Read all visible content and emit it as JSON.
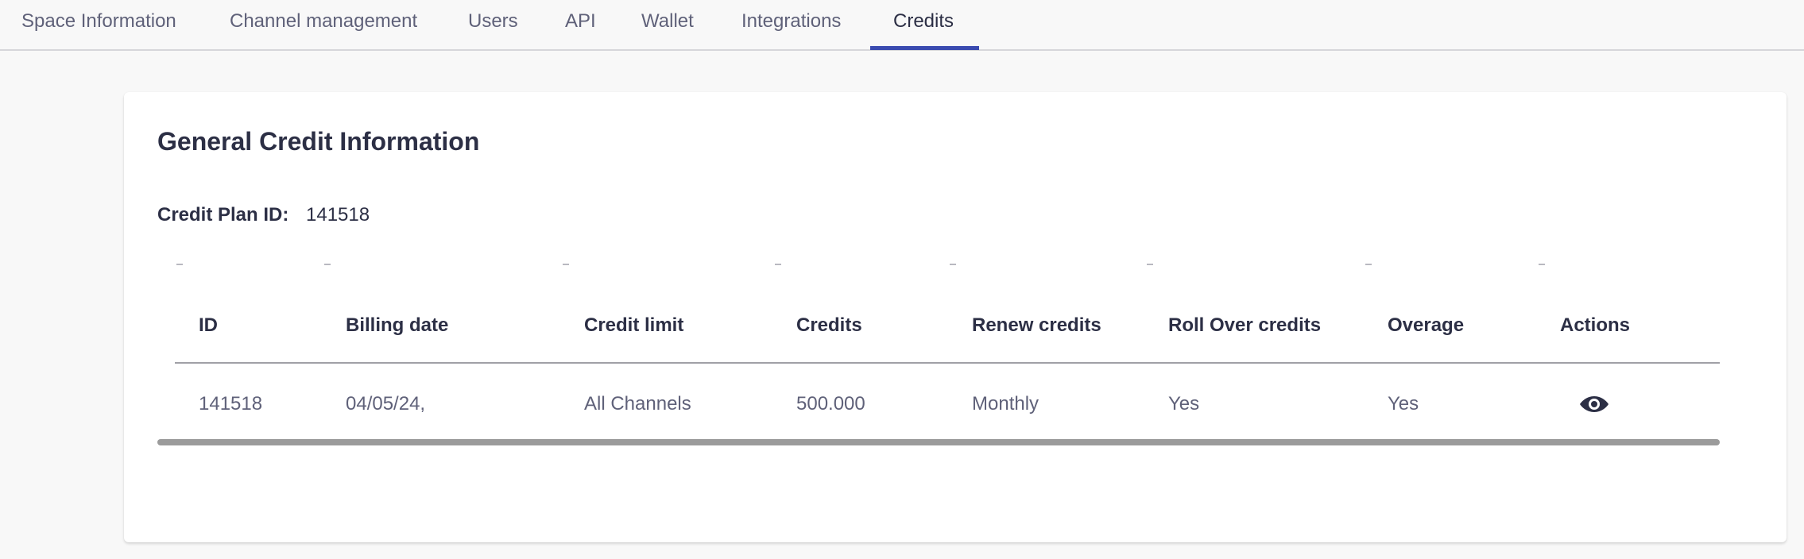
{
  "tabs": [
    {
      "label": "Space Information"
    },
    {
      "label": "Channel management"
    },
    {
      "label": "Users"
    },
    {
      "label": "API"
    },
    {
      "label": "Wallet"
    },
    {
      "label": "Integrations"
    },
    {
      "label": "Credits",
      "active": true
    }
  ],
  "card": {
    "title": "General Credit Information",
    "plan_label": "Credit Plan ID:",
    "plan_value": "141518"
  },
  "table": {
    "columns": [
      "ID",
      "Billing date",
      "Credit limit",
      "Credits",
      "Renew credits",
      "Roll Over credits",
      "Overage",
      "Actions"
    ],
    "rows": [
      {
        "id": "141518",
        "billing_date": "04/05/24,",
        "credit_limit": "All Channels",
        "credits": "500.000",
        "renew": "Monthly",
        "roll_over": "Yes",
        "overage": "Yes",
        "action_icon": "eye-icon"
      }
    ]
  },
  "colors": {
    "accent": "#3a4bb0",
    "text_dark": "#2c2f45",
    "text_muted": "#5f6179"
  }
}
